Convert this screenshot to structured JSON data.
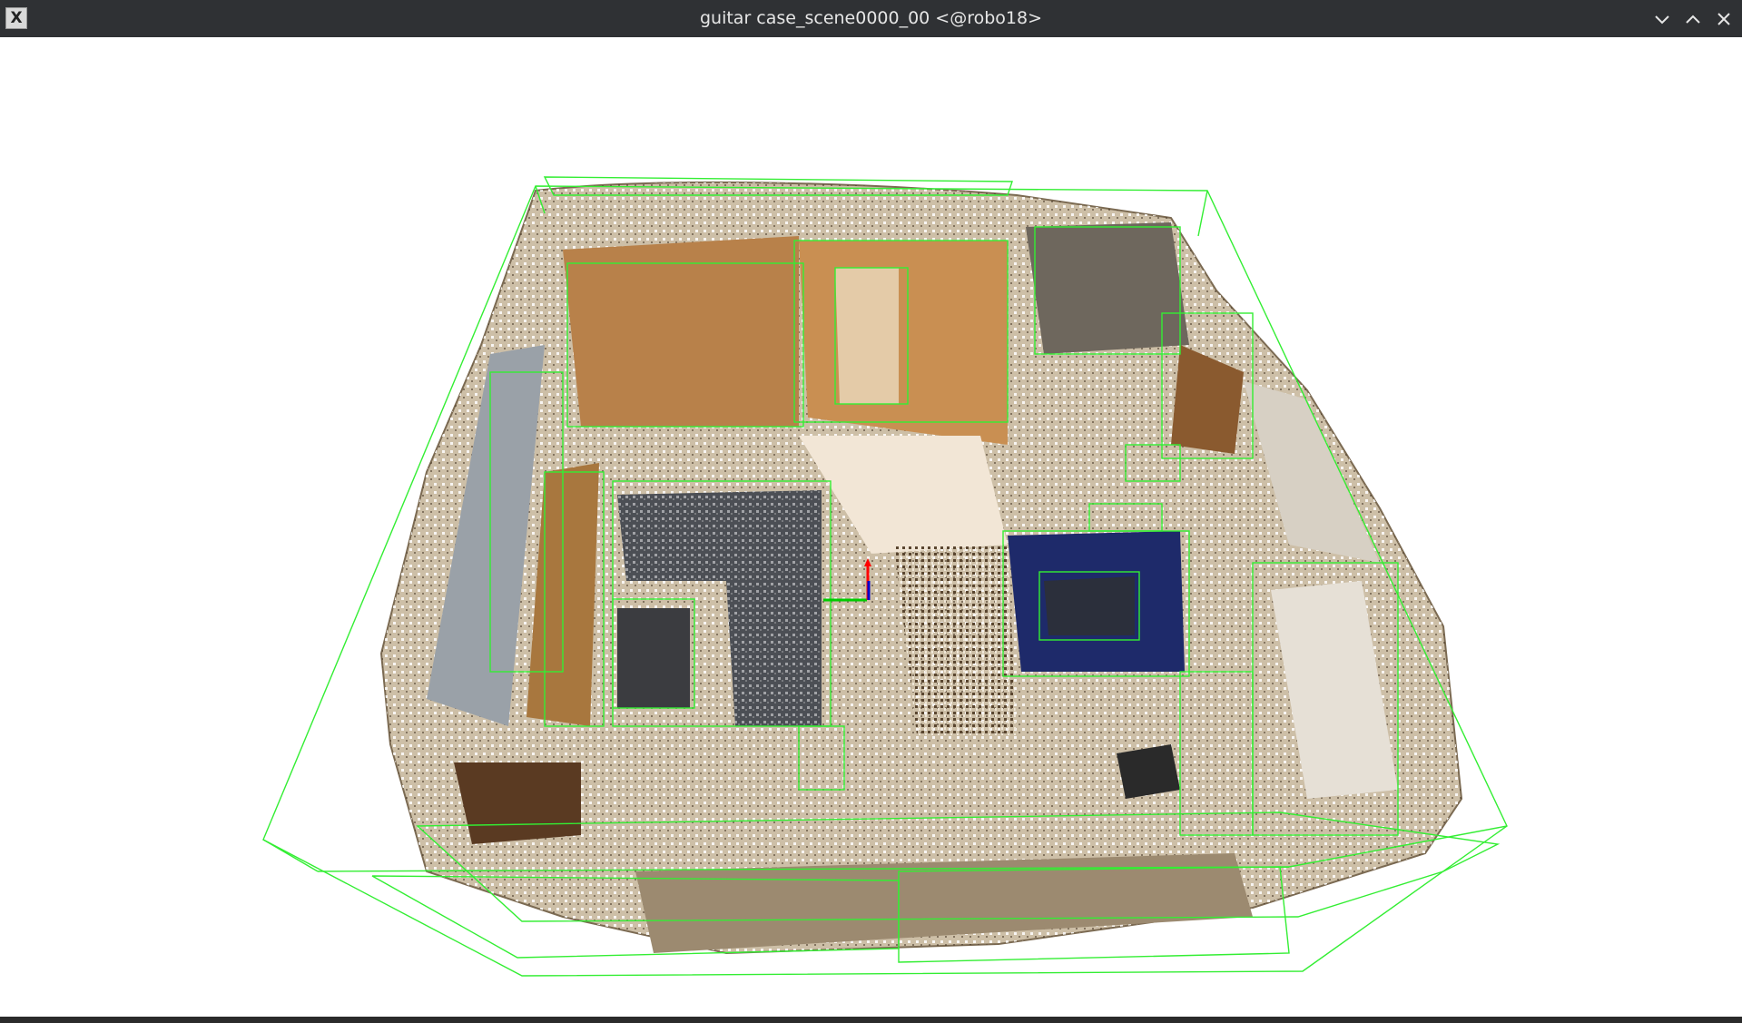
{
  "window": {
    "app_icon_glyph": "X",
    "title": "guitar case_scene0000_00 <@robo18>",
    "buttons": {
      "minimize": "chevron-down-icon",
      "maximize": "chevron-up-icon",
      "close": "close-icon"
    }
  },
  "scene": {
    "view": "3D point cloud with oriented bounding boxes",
    "box_color": "#33ee33",
    "axes_colors": {
      "x": "#00cc00",
      "y": "#ff0000",
      "z": "#0000cc"
    }
  }
}
